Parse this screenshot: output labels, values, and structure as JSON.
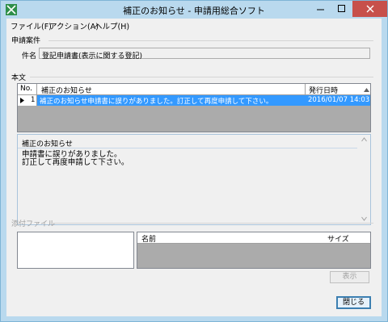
{
  "window": {
    "title": "補正のお知らせ - 申請用総合ソフト"
  },
  "menu": {
    "items": [
      "ファイル(F)",
      "アクション(A)",
      "ヘルプ(H)"
    ]
  },
  "case": {
    "section_label": "申請案件",
    "field_label": "件名",
    "field_value": "登記申請書(表示に関する登記)"
  },
  "body": {
    "section_label": "本文",
    "columns": [
      "No.",
      "補正のお知らせ",
      "発行日時"
    ],
    "rows": [
      {
        "no": "1",
        "subject": "補正のお知らせ申請書に誤りがありました。訂正して再度申請して下さい。",
        "date": "2016/01/07 14:03"
      }
    ],
    "message_label": "補正のお知らせ",
    "message_text": "申請書に誤りがありました。\n訂正して再度申請して下さい。"
  },
  "attachments": {
    "section_label": "添付ファイル",
    "columns": [
      "名前",
      "サイズ"
    ],
    "show_label": "表示"
  },
  "footer": {
    "close_label": "閉じる"
  },
  "colors": {
    "selection": "#3399ff",
    "titlebar": "#b9d9ee",
    "close": "#c7504b"
  }
}
